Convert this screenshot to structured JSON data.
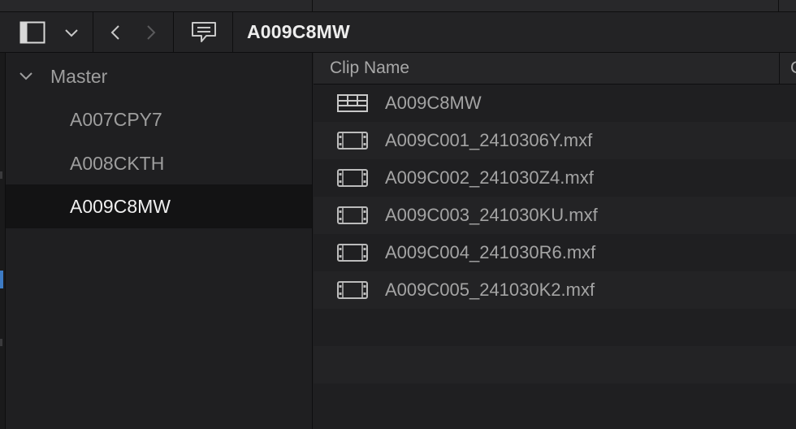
{
  "toolbar": {
    "title": "A009C8MW",
    "icons": [
      "sidebar-toggle-icon",
      "chevron-down-icon",
      "back-arrow-icon",
      "forward-arrow-icon",
      "metadata-icon"
    ]
  },
  "sidebar": {
    "root": {
      "label": "Master",
      "expanded": true
    },
    "items": [
      {
        "label": "A007CPY7",
        "selected": false
      },
      {
        "label": "A008CKTH",
        "selected": false
      },
      {
        "label": "A009C8MW",
        "selected": true
      }
    ]
  },
  "clip_list": {
    "columns": [
      "Clip Name",
      "C"
    ],
    "rows": [
      {
        "name": "A009C8MW",
        "icon": "timeline-icon"
      },
      {
        "name": "A009C001_2410306Y.mxf",
        "icon": "film-clip-icon"
      },
      {
        "name": "A009C002_241030Z4.mxf",
        "icon": "film-clip-icon"
      },
      {
        "name": "A009C003_241030KU.mxf",
        "icon": "film-clip-icon"
      },
      {
        "name": "A009C004_241030R6.mxf",
        "icon": "film-clip-icon"
      },
      {
        "name": "A009C005_241030K2.mxf",
        "icon": "film-clip-icon"
      }
    ]
  },
  "colors": {
    "background": "#1f1f21",
    "selected_row": "#131314",
    "accent_blue": "#3d7bc4",
    "text_primary": "#f0f0f0",
    "text_secondary": "#a4a4a4"
  }
}
